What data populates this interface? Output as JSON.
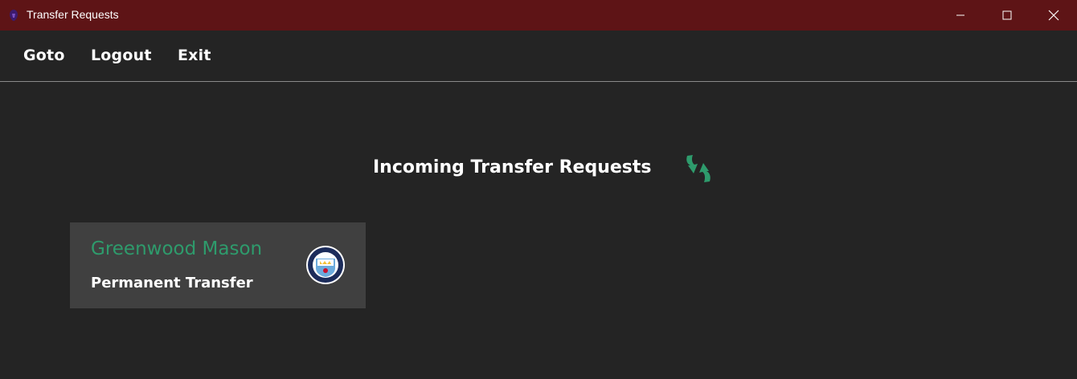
{
  "window": {
    "title": "Transfer Requests",
    "controls": [
      "minimize",
      "maximize",
      "close"
    ],
    "titlebar_color": "#5e1416"
  },
  "menu": {
    "items": [
      {
        "label": "Goto"
      },
      {
        "label": "Logout"
      },
      {
        "label": "Exit"
      }
    ]
  },
  "main": {
    "heading": "Incoming Transfer Requests",
    "refresh_icon": "refresh-arrows-icon",
    "accent_color": "#2e9b6c"
  },
  "requests": [
    {
      "player_name": "Greenwood Mason",
      "transfer_type": "Permanent Transfer",
      "club_badge_icon": "club-crest-icon"
    }
  ]
}
